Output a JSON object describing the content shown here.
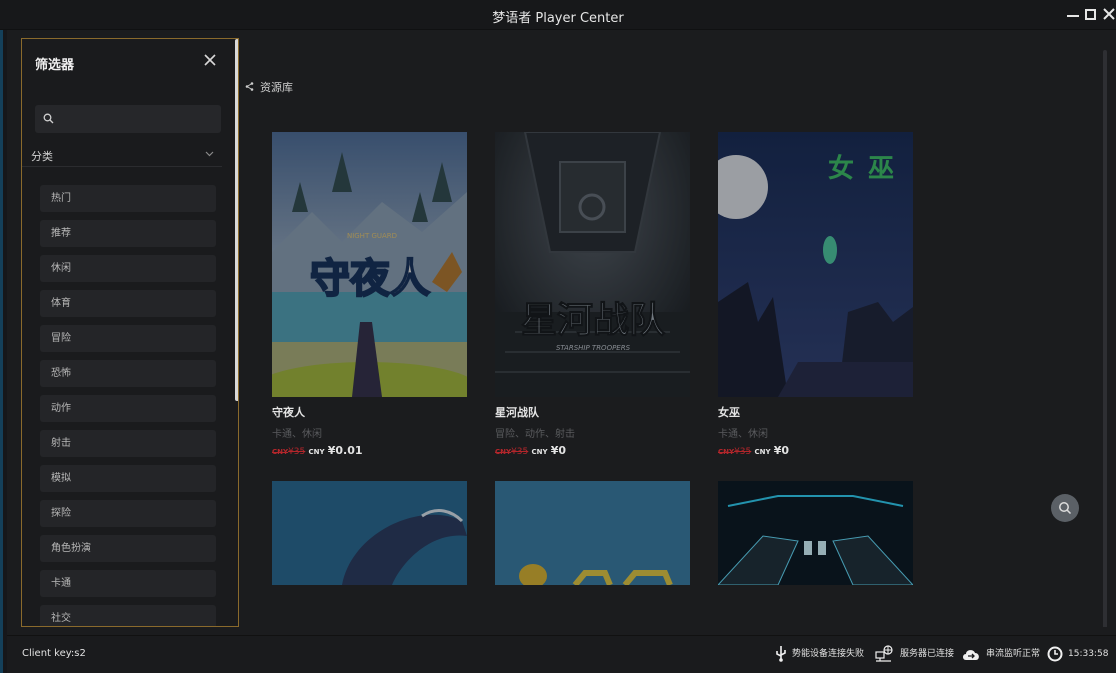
{
  "window": {
    "title": "梦语者 Player Center"
  },
  "sidebar": {
    "title": "筛选器",
    "search_placeholder": "",
    "category_label": "分类",
    "categories": [
      "热门",
      "推荐",
      "休闲",
      "体育",
      "冒险",
      "恐怖",
      "动作",
      "射击",
      "模拟",
      "探险",
      "角色扮演",
      "卡通",
      "社交"
    ]
  },
  "main": {
    "breadcrumb": "资源库",
    "games": [
      {
        "name": "守夜人",
        "tags": "卡通、休闲",
        "old_price": "¥35",
        "currency": "CNY",
        "price": "¥0.01",
        "cover_text": "守夜人",
        "cover_subtext": "NIGHT GUARD"
      },
      {
        "name": "星河战队",
        "tags": "冒险、动作、射击",
        "old_price": "¥35",
        "currency": "CNY",
        "price": "¥0",
        "cover_text": "星河战队",
        "cover_subtext": "STARSHIP TROOPERS"
      },
      {
        "name": "女巫",
        "tags": "卡通、休闲",
        "old_price": "¥35",
        "currency": "CNY",
        "price": "¥0",
        "cover_text": "女巫",
        "cover_subtext": ""
      }
    ]
  },
  "status": {
    "client_key": "Client key:s2",
    "device_status": "势能设备连接失败",
    "server_status": "服务器已连接",
    "stream_status": "串流监听正常",
    "time": "15:33:58"
  },
  "colors": {
    "accent_border": "#8a6a2c",
    "price_strike": "#b3262b",
    "background": "#1b1c1e"
  }
}
